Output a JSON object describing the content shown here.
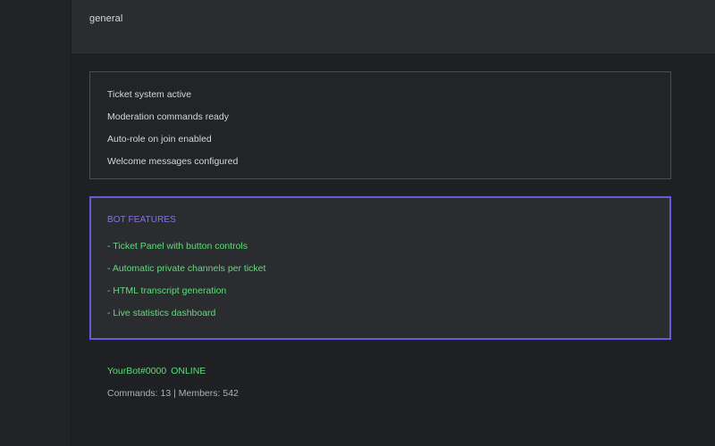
{
  "header": {
    "channel_name": "general"
  },
  "status": {
    "items": [
      "Ticket system active",
      "Moderation commands ready",
      "Auto-role on join enabled",
      "Welcome messages configured"
    ]
  },
  "features": {
    "title": "BOT FEATURES",
    "items": [
      "- Ticket Panel with button controls",
      "- Automatic private channels per ticket",
      "- HTML transcript generation",
      "- Live statistics dashboard"
    ]
  },
  "bot": {
    "tag": "YourBot#0000",
    "status": "ONLINE",
    "stats": "Commands: 13 | Members: 542"
  },
  "colors": {
    "accent": "#6b58d8",
    "feature_text": "#5fdc7c",
    "background": "#1f2023"
  }
}
